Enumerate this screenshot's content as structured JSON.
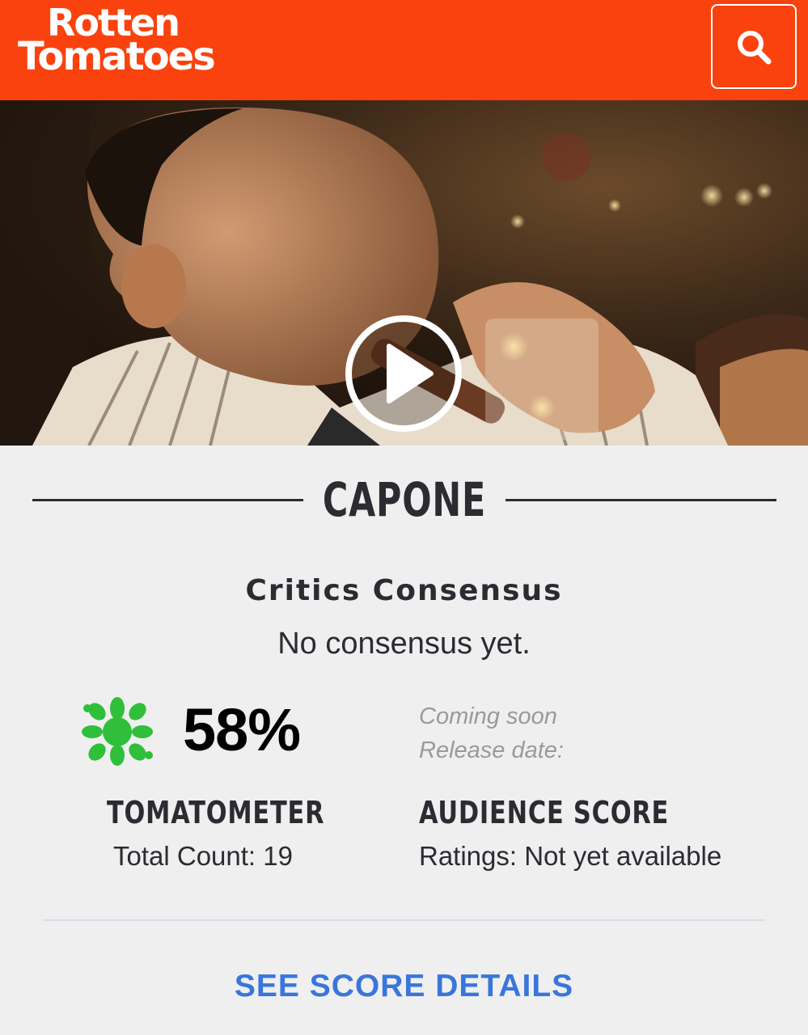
{
  "header": {
    "logo_line1": "Rotten",
    "logo_line2": "Tomatoes",
    "brand_color": "#fa420f",
    "search_icon": "search-icon"
  },
  "hero": {
    "play_icon": "play-icon"
  },
  "movie": {
    "title": "CAPONE",
    "critics_consensus_heading": "Critics Consensus",
    "critics_consensus_text": "No consensus yet."
  },
  "tomatometer": {
    "score": "58%",
    "label": "TOMATOMETER",
    "count": "Total Count: 19",
    "icon": "rotten-splat-icon",
    "icon_color": "#2fbf3a"
  },
  "audience": {
    "status_line1": "Coming soon",
    "status_line2": "Release date:",
    "label": "AUDIENCE SCORE",
    "ratings": "Ratings: Not yet available"
  },
  "links": {
    "see_score_details": "SEE SCORE DETAILS",
    "link_color": "#3976dc"
  }
}
